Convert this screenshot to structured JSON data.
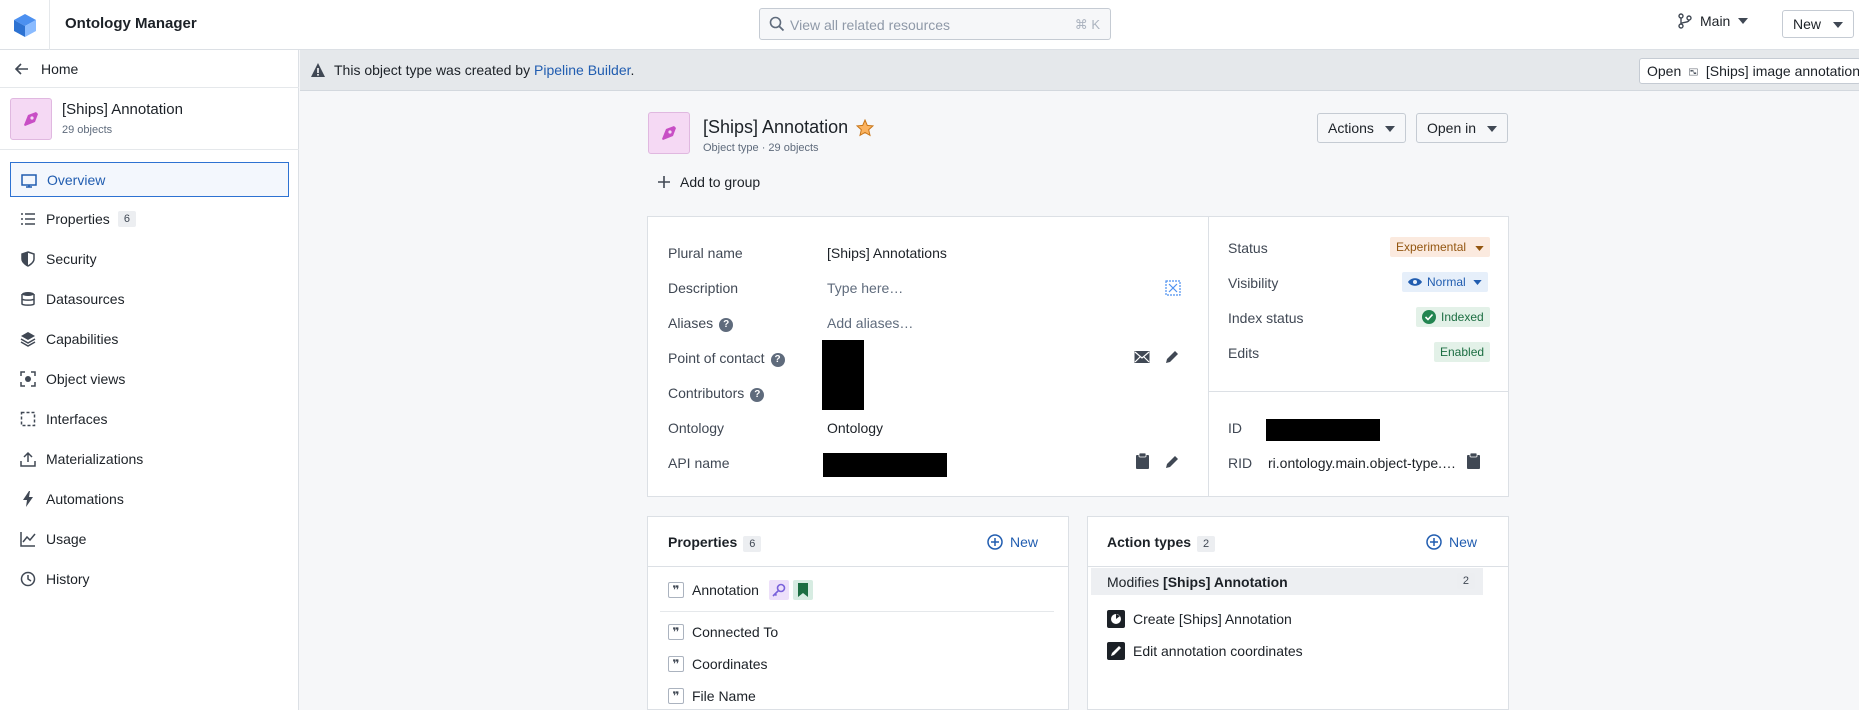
{
  "app": {
    "title": "Ontology Manager"
  },
  "search": {
    "placeholder": "View all related resources",
    "shortcut": "⌘ K"
  },
  "branch": {
    "label": "Main"
  },
  "top_new": {
    "label": "New"
  },
  "sidebar": {
    "home": "Home",
    "object": {
      "name": "[Ships] Annotation",
      "count": "29 objects"
    },
    "items": [
      {
        "label": "Overview",
        "icon": "monitor-icon",
        "active": true
      },
      {
        "label": "Properties",
        "icon": "list-icon",
        "badge": "6"
      },
      {
        "label": "Security",
        "icon": "shield-icon"
      },
      {
        "label": "Datasources",
        "icon": "database-icon"
      },
      {
        "label": "Capabilities",
        "icon": "layers-icon"
      },
      {
        "label": "Object views",
        "icon": "object-view-icon"
      },
      {
        "label": "Interfaces",
        "icon": "interface-icon"
      },
      {
        "label": "Materializations",
        "icon": "export-icon"
      },
      {
        "label": "Automations",
        "icon": "lightning-icon"
      },
      {
        "label": "Usage",
        "icon": "chart-icon"
      },
      {
        "label": "History",
        "icon": "history-icon"
      }
    ]
  },
  "banner": {
    "text_before": "This object type was created by",
    "link": "Pipeline Builder",
    "text_after": ".",
    "open_label": "Open",
    "open_target": "[Ships] image annotation"
  },
  "header": {
    "title": "[Ships] Annotation",
    "subtitle": "Object type · 29 objects",
    "actions_label": "Actions",
    "open_in_label": "Open in",
    "add_group_label": "Add to group"
  },
  "details": {
    "plural_label": "Plural name",
    "plural_value": "[Ships] Annotations",
    "description_label": "Description",
    "description_placeholder": "Type here…",
    "aliases_label": "Aliases",
    "aliases_placeholder": "Add aliases…",
    "poc_label": "Point of contact",
    "contributors_label": "Contributors",
    "ontology_label": "Ontology",
    "ontology_value": "Ontology",
    "api_label": "API name"
  },
  "status_panel": {
    "status_label": "Status",
    "status_value": "Experimental",
    "visibility_label": "Visibility",
    "visibility_value": "Normal",
    "index_label": "Index status",
    "index_value": "Indexed",
    "edits_label": "Edits",
    "edits_value": "Enabled",
    "id_label": "ID",
    "rid_label": "RID",
    "rid_value": "ri.ontology.main.object-type.…"
  },
  "properties_card": {
    "title": "Properties",
    "count": "6",
    "new_label": "New",
    "items": [
      "Annotation",
      "Connected To",
      "Coordinates",
      "File Name"
    ]
  },
  "actions_card": {
    "title": "Action types",
    "count": "2",
    "new_label": "New",
    "group_prefix": "Modifies",
    "group_name": "[Ships] Annotation",
    "group_count": "2",
    "items": [
      "Create [Ships] Annotation",
      "Edit annotation coordinates"
    ]
  }
}
